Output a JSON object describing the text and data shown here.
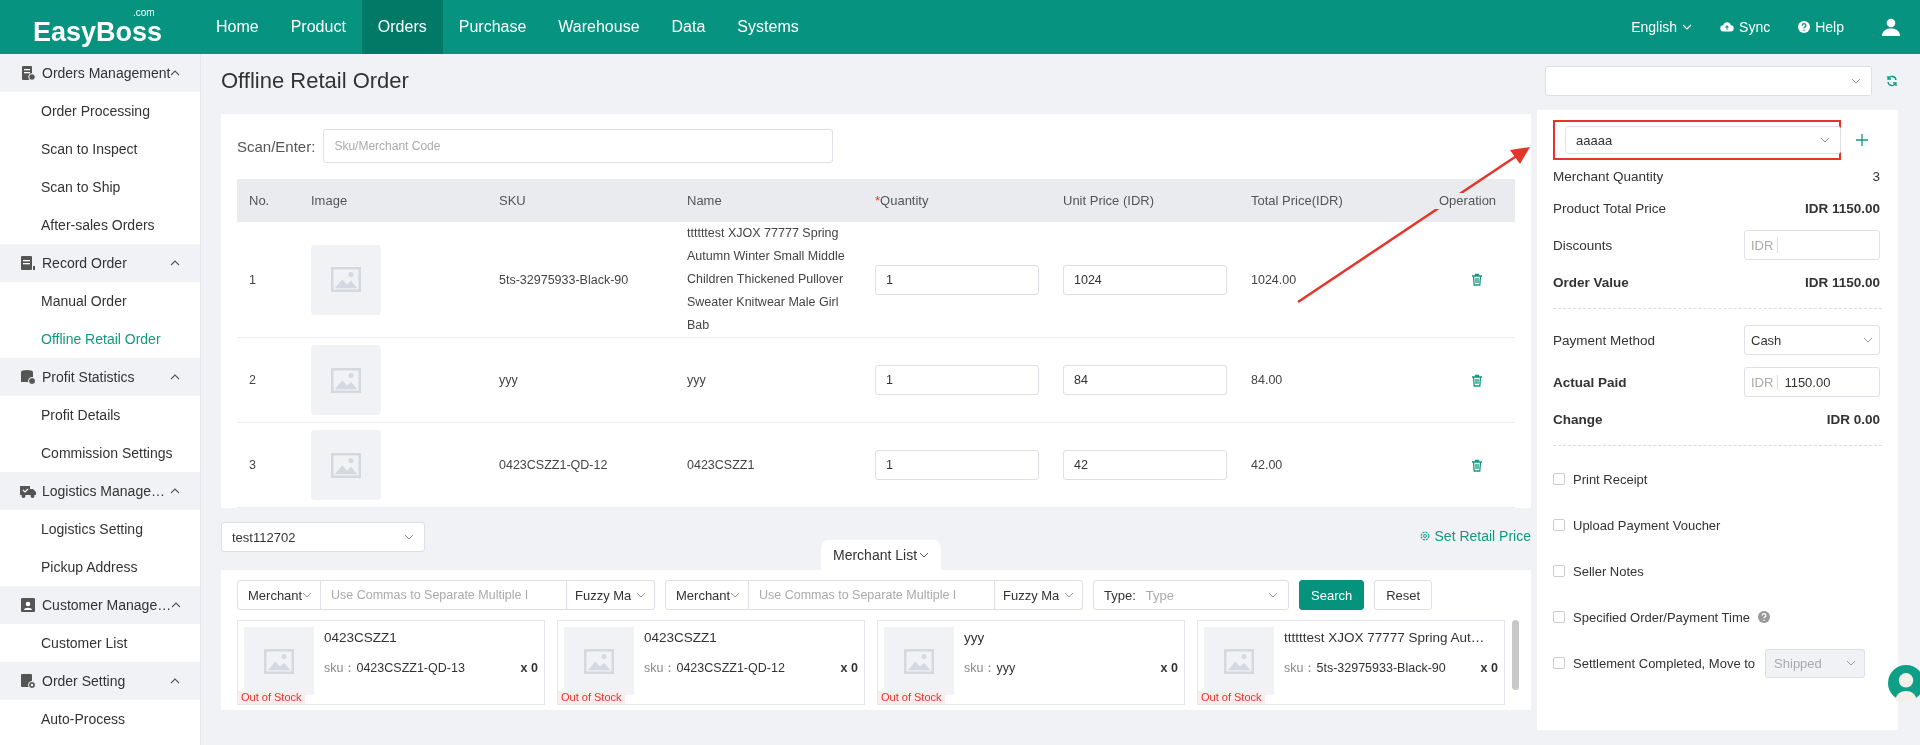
{
  "brand": {
    "name": "EasyBoss",
    "suffix": ".com"
  },
  "nav": [
    {
      "label": "Home",
      "selected": false
    },
    {
      "label": "Product",
      "selected": false
    },
    {
      "label": "Orders",
      "selected": true
    },
    {
      "label": "Purchase",
      "selected": false
    },
    {
      "label": "Warehouse",
      "selected": false
    },
    {
      "label": "Data",
      "selected": false
    },
    {
      "label": "Systems",
      "selected": false
    }
  ],
  "header_right": {
    "language": "English",
    "sync": "Sync",
    "help": "Help"
  },
  "sidebar": [
    {
      "label": "Orders Management",
      "expanded": true,
      "children": [
        {
          "label": "Order Processing",
          "selected": false
        },
        {
          "label": "Scan to Inspect",
          "selected": false
        },
        {
          "label": "Scan to Ship",
          "selected": false
        },
        {
          "label": "After-sales Orders",
          "selected": false
        }
      ]
    },
    {
      "label": "Record Order",
      "expanded": true,
      "children": [
        {
          "label": "Manual Order",
          "selected": false
        },
        {
          "label": "Offline Retail Order",
          "selected": true
        }
      ]
    },
    {
      "label": "Profit Statistics",
      "expanded": true,
      "children": [
        {
          "label": "Profit Details",
          "selected": false
        },
        {
          "label": "Commission Settings",
          "selected": false
        }
      ]
    },
    {
      "label": "Logistics Manage…",
      "expanded": true,
      "children": [
        {
          "label": "Logistics Setting",
          "selected": false
        },
        {
          "label": "Pickup Address",
          "selected": false
        }
      ]
    },
    {
      "label": "Customer Manage…",
      "expanded": true,
      "children": [
        {
          "label": "Customer List",
          "selected": false
        }
      ]
    },
    {
      "label": "Order Setting",
      "expanded": true,
      "children": [
        {
          "label": "Auto-Process",
          "selected": false
        }
      ]
    }
  ],
  "page_title": "Offline Retail Order",
  "scan": {
    "label": "Scan/Enter:",
    "placeholder": "Sku/Merchant Code"
  },
  "table": {
    "columns": [
      {
        "label": "No."
      },
      {
        "label": "Image"
      },
      {
        "label": "SKU"
      },
      {
        "label": "Name"
      },
      {
        "label": "Quantity",
        "mark": "*"
      },
      {
        "label": "Unit Price (IDR)"
      },
      {
        "label": "Total Price(IDR)"
      },
      {
        "label": "Operation"
      }
    ],
    "rows": [
      {
        "no": "1",
        "sku": "5ts-32975933-Black-90",
        "name": "ttttttest XJOX 77777 Spring Autumn Winter Small Middle Children Thickened Pullover Sweater Knitwear Male Girl Bab",
        "quantity": "1",
        "unit_price": "1024",
        "total": "1024.00"
      },
      {
        "no": "2",
        "sku": "yyy",
        "name": "yyy",
        "quantity": "1",
        "unit_price": "84",
        "total": "84.00"
      },
      {
        "no": "3",
        "sku": "0423CSZZ1-QD-12",
        "name": "0423CSZZ1",
        "quantity": "1",
        "unit_price": "42",
        "total": "42.00"
      }
    ]
  },
  "store_select": "test112702",
  "merchant_tab": "Merchant List",
  "set_price": "Set Retail Price",
  "filters": [
    {
      "field": "Merchant",
      "placeholder": "Use Commas to Separate Multiple I",
      "mode": "Fuzzy Ma"
    },
    {
      "field": "Merchant",
      "placeholder": "Use Commas to Separate Multiple I",
      "mode": "Fuzzy Ma"
    }
  ],
  "type_filter": {
    "label": "Type:",
    "placeholder": "Type"
  },
  "buttons": {
    "search": "Search",
    "reset": "Reset"
  },
  "merchants": [
    {
      "name": "0423CSZZ1",
      "sku_label": "sku：",
      "sku": "0423CSZZ1-QD-13",
      "qty": "x 0",
      "stock": "Out of Stock"
    },
    {
      "name": "0423CSZZ1",
      "sku_label": "sku：",
      "sku": "0423CSZZ1-QD-12",
      "qty": "x 0",
      "stock": "Out of Stock"
    },
    {
      "name": "yyy",
      "sku_label": "sku：",
      "sku": "yyy",
      "qty": "x 0",
      "stock": "Out of Stock"
    },
    {
      "name": "ttttttest XJOX 77777 Spring Aut…",
      "sku_label": "sku：",
      "sku": "5ts-32975933-Black-90",
      "qty": "x 0",
      "stock": "Out of Stock"
    }
  ],
  "summary": {
    "customer_select": "aaaaa",
    "merchant_qty": {
      "label": "Merchant Quantity",
      "value": "3"
    },
    "product_total": {
      "label": "Product Total Price",
      "value": "IDR 1150.00"
    },
    "discounts": {
      "label": "Discounts",
      "prefix": "IDR"
    },
    "order_value": {
      "label": "Order Value",
      "value": "IDR 1150.00"
    },
    "payment": {
      "label": "Payment Method",
      "value": "Cash"
    },
    "actual_paid": {
      "label": "Actual Paid",
      "prefix": "IDR",
      "value": "1150.00"
    },
    "change": {
      "label": "Change",
      "value": "IDR 0.00"
    }
  },
  "options": [
    {
      "kind": "plain",
      "label": "Print Receipt",
      "checked": false
    },
    {
      "kind": "plain",
      "label": "Upload Payment Voucher",
      "checked": false
    },
    {
      "kind": "plain",
      "label": "Seller Notes",
      "checked": false
    },
    {
      "kind": "help",
      "label": "Specified Order/Payment Time",
      "checked": false
    },
    {
      "kind": "select",
      "label": "Settlement Completed, Move to",
      "checked": false,
      "select_value": "Shipped",
      "select_disabled": true
    }
  ]
}
